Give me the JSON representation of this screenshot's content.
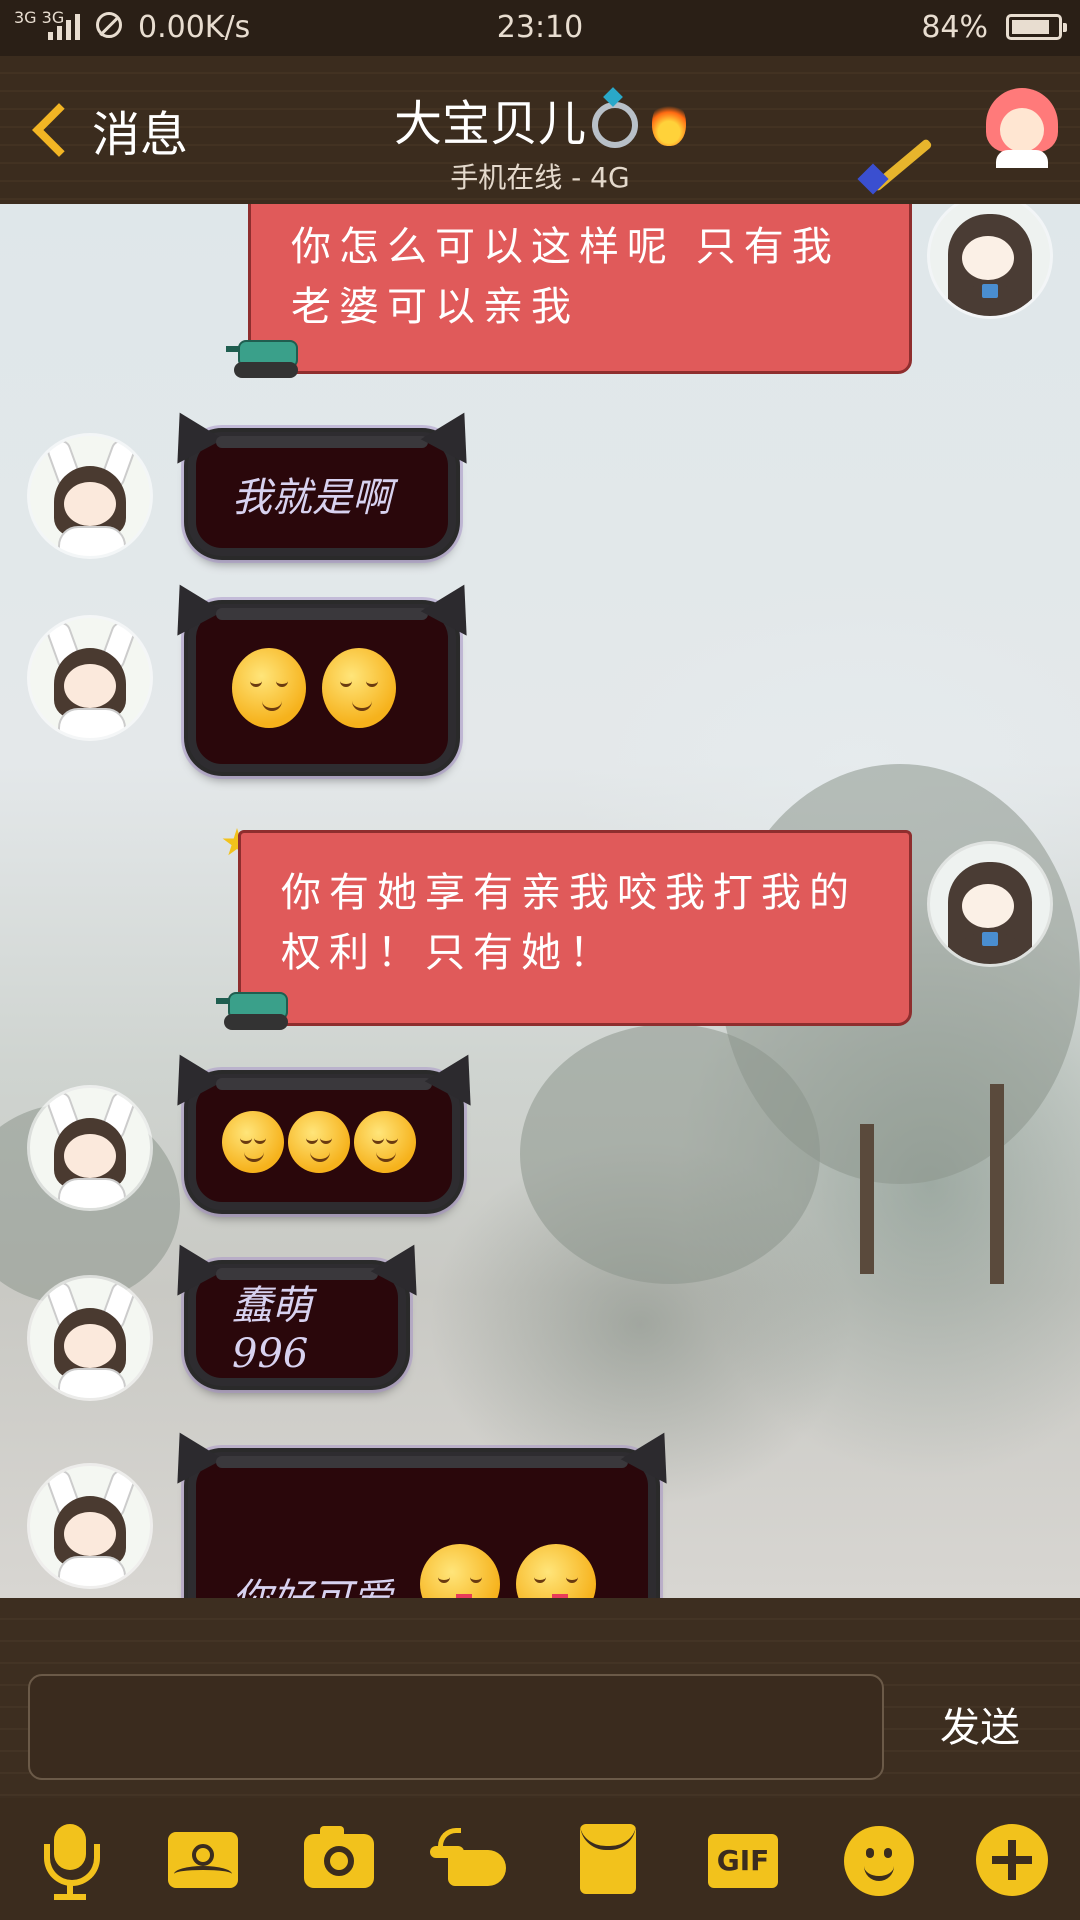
{
  "status_bar": {
    "network": "3G 3G",
    "speed": "0.00K/s",
    "time": "23:10",
    "battery_percent": "84%",
    "battery_level": 0.84
  },
  "header": {
    "back_label": "消息",
    "title": "大宝贝儿",
    "subtitle": "手机在线 - 4G"
  },
  "messages": [
    {
      "side": "right",
      "style": "red-flag",
      "text": "你怎么可以这样呢  只有我老婆可以亲我"
    },
    {
      "side": "left",
      "style": "dark-bat",
      "text": "我就是啊"
    },
    {
      "side": "left",
      "style": "dark-bat",
      "emojis": [
        "shy-smile-emoji",
        "shy-smile-emoji"
      ]
    },
    {
      "side": "right",
      "style": "red-flag",
      "text": "你有她享有亲我咬我打我的权利！只有她！"
    },
    {
      "side": "left",
      "style": "dark-bat",
      "emojis": [
        "blush-smile-emoji",
        "blush-smile-emoji",
        "blush-smile-emoji"
      ]
    },
    {
      "side": "left",
      "style": "dark-bat",
      "text": "蠢萌996"
    },
    {
      "side": "left",
      "style": "dark-bat",
      "text": "你好可爱",
      "emojis": [
        "tongue-emoji",
        "tongue-emoji"
      ]
    }
  ],
  "composer": {
    "input_value": "",
    "send_label": "发送"
  },
  "toolbar": {
    "items": [
      "mic-icon",
      "image-icon",
      "camera-icon",
      "poke-icon",
      "red-packet-icon",
      "gif-icon",
      "emoji-icon",
      "plus-icon"
    ],
    "gif_label": "GIF"
  },
  "colors": {
    "accent": "#f2c21c",
    "header_bg": "#3b2c1e",
    "red_bubble": "#e05a5a",
    "dark_bubble": "#2a070b"
  }
}
